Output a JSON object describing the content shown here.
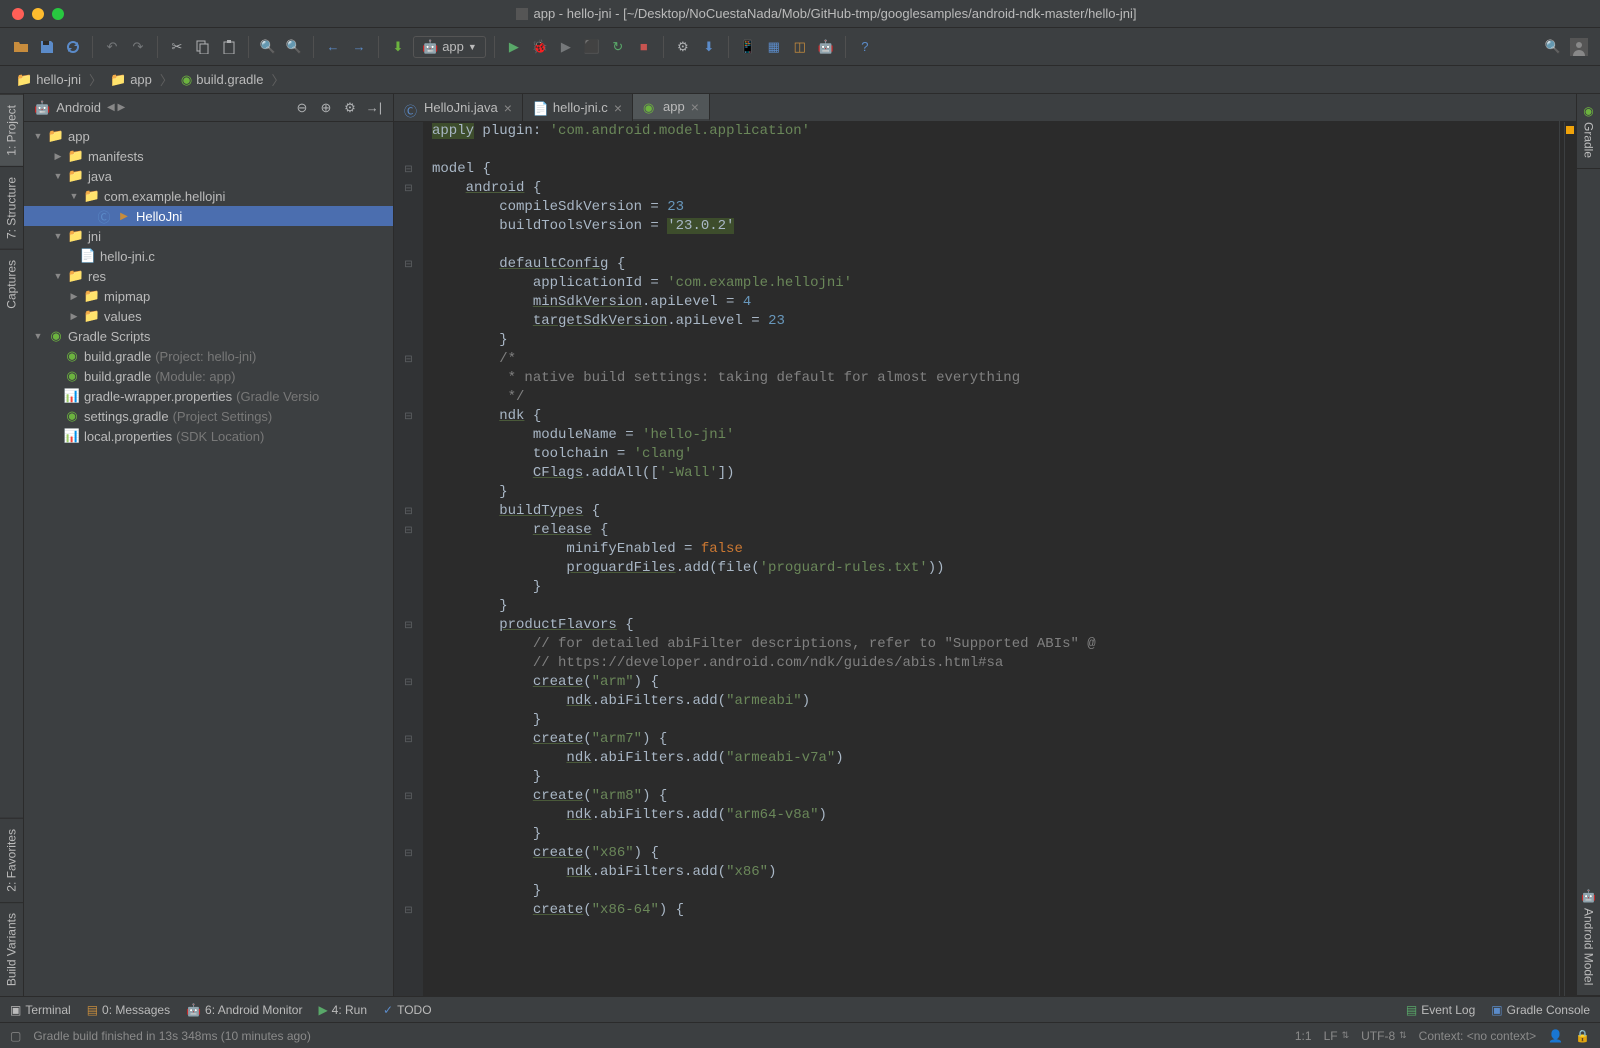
{
  "window": {
    "title": "app - hello-jni - [~/Desktop/NoCuestaNada/Mob/GitHub-tmp/googlesamples/android-ndk-master/hello-jni]"
  },
  "breadcrumb": {
    "items": [
      "hello-jni",
      "app",
      "build.gradle"
    ]
  },
  "runConfig": {
    "label": "app"
  },
  "projectPanel": {
    "viewLabel": "Android",
    "tree": {
      "app": "app",
      "manifests": "manifests",
      "java": "java",
      "pkg": "com.example.hellojni",
      "hellojni": "HelloJni",
      "jni": "jni",
      "hellojnic": "hello-jni.c",
      "res": "res",
      "mipmap": "mipmap",
      "values": "values",
      "gradleScripts": "Gradle Scripts",
      "buildGradle1": "build.gradle",
      "buildGradle1Hint": "(Project: hello-jni)",
      "buildGradle2": "build.gradle",
      "buildGradle2Hint": "(Module: app)",
      "gradleWrapper": "gradle-wrapper.properties",
      "gradleWrapperHint": "(Gradle Versio",
      "settingsGradle": "settings.gradle",
      "settingsGradleHint": "(Project Settings)",
      "localProps": "local.properties",
      "localPropsHint": "(SDK Location)"
    }
  },
  "leftTools": {
    "project": "1: Project",
    "structure": "7: Structure",
    "captures": "Captures",
    "favorites": "2: Favorites",
    "buildVariants": "Build Variants"
  },
  "rightTools": {
    "gradle": "Gradle",
    "androidModel": "Android Model"
  },
  "editorTabs": {
    "tab1": "HelloJni.java",
    "tab2": "hello-jni.c",
    "tab3": "app"
  },
  "code": {
    "l1a": "apply",
    "l1b": " plugin: ",
    "l1c": "'com.android.model.application'",
    "l2": "",
    "l3": "model {",
    "l4a": "    ",
    "l4b": "android",
    "l4c": " {",
    "l5a": "        compileSdkVersion = ",
    "l5b": "23",
    "l6a": "        buildToolsVersion = ",
    "l6b": "'23.0.2'",
    "l7": "",
    "l8a": "        ",
    "l8b": "defaultConfig",
    "l8c": " {",
    "l9a": "            applicationId = ",
    "l9b": "'com.example.hellojni'",
    "l10a": "            ",
    "l10b": "minSdkVersion",
    "l10c": ".apiLevel = ",
    "l10d": "4",
    "l11a": "            ",
    "l11b": "targetSdkVersion",
    "l11c": ".apiLevel = ",
    "l11d": "23",
    "l12": "        }",
    "l13": "        /*",
    "l14": "         * native build settings: taking default for almost everything",
    "l15": "         */",
    "l16a": "        ",
    "l16b": "ndk",
    "l16c": " {",
    "l17a": "            moduleName = ",
    "l17b": "'hello-jni'",
    "l18a": "            toolchain = ",
    "l18b": "'clang'",
    "l19a": "            ",
    "l19b": "CFlags",
    "l19c": ".addAll([",
    "l19d": "'-Wall'",
    "l19e": "])",
    "l20": "        }",
    "l21a": "        ",
    "l21b": "buildTypes",
    "l21c": " {",
    "l22a": "            ",
    "l22b": "release",
    "l22c": " {",
    "l23a": "                minifyEnabled = ",
    "l23b": "false",
    "l24a": "                ",
    "l24b": "proguardFiles",
    "l24c": ".add(file(",
    "l24d": "'proguard-rules.txt'",
    "l24e": "))",
    "l25": "            }",
    "l26": "        }",
    "l27a": "        ",
    "l27b": "productFlavors",
    "l27c": " {",
    "l28": "            // for detailed abiFilter descriptions, refer to \"Supported ABIs\" @",
    "l29": "            // https://developer.android.com/ndk/guides/abis.html#sa",
    "l30a": "            ",
    "l30b": "create",
    "l30c": "(",
    "l30d": "\"arm\"",
    "l30e": ") {",
    "l31a": "                ",
    "l31b": "ndk",
    "l31c": ".abiFilters.add(",
    "l31d": "\"armeabi\"",
    "l31e": ")",
    "l32": "            }",
    "l33a": "            ",
    "l33b": "create",
    "l33c": "(",
    "l33d": "\"arm7\"",
    "l33e": ") {",
    "l34a": "                ",
    "l34b": "ndk",
    "l34c": ".abiFilters.add(",
    "l34d": "\"armeabi-v7a\"",
    "l34e": ")",
    "l35": "            }",
    "l36a": "            ",
    "l36b": "create",
    "l36c": "(",
    "l36d": "\"arm8\"",
    "l36e": ") {",
    "l37a": "                ",
    "l37b": "ndk",
    "l37c": ".abiFilters.add(",
    "l37d": "\"arm64-v8a\"",
    "l37e": ")",
    "l38": "            }",
    "l39a": "            ",
    "l39b": "create",
    "l39c": "(",
    "l39d": "\"x86\"",
    "l39e": ") {",
    "l40a": "                ",
    "l40b": "ndk",
    "l40c": ".abiFilters.add(",
    "l40d": "\"x86\"",
    "l40e": ")",
    "l41": "            }",
    "l42a": "            ",
    "l42b": "create",
    "l42c": "(",
    "l42d": "\"x86-64\"",
    "l42e": ") {"
  },
  "bottomTools": {
    "terminal": "Terminal",
    "messages": "0: Messages",
    "androidMonitor": "6: Android Monitor",
    "run": "4: Run",
    "todo": "TODO",
    "eventLog": "Event Log",
    "gradleConsole": "Gradle Console"
  },
  "statusBar": {
    "message": "Gradle build finished in 13s 348ms (10 minutes ago)",
    "pos": "1:1",
    "lf": "LF",
    "encoding": "UTF-8",
    "context": "Context: <no context>"
  }
}
